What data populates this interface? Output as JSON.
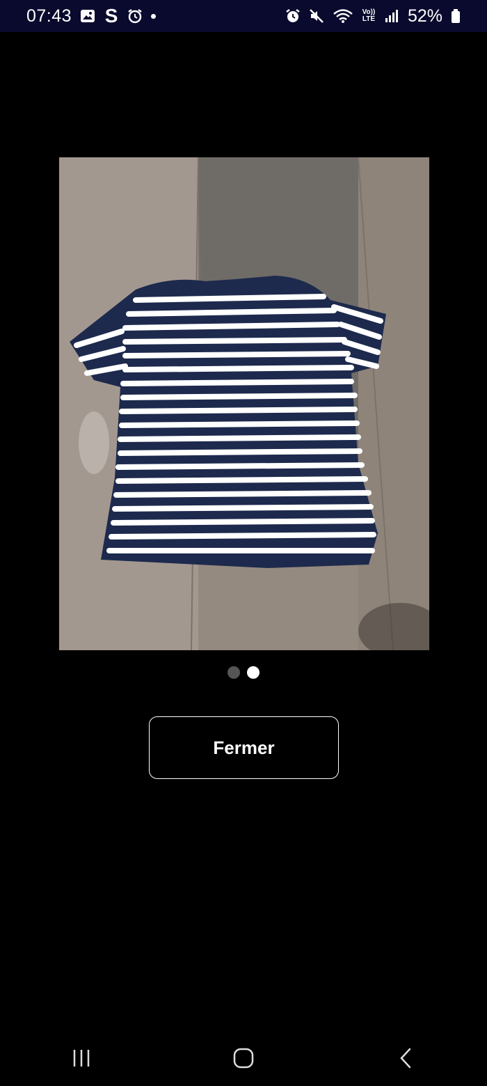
{
  "status_bar": {
    "time": "07:43",
    "battery": "52%",
    "left_icons": [
      "gallery-icon",
      "s-app-icon",
      "alarm-icon",
      "notification-dot"
    ],
    "right_icons": [
      "alarm-icon",
      "mute-icon",
      "wifi-icon",
      "volte-icon",
      "signal-icon",
      "battery-icon"
    ],
    "volte_label_top": "Vo))",
    "volte_label_bottom": "LTE",
    "s_glyph": "S"
  },
  "viewer": {
    "photo_subject": "striped-tshirt-photo",
    "pager": {
      "total": 2,
      "current": 2
    }
  },
  "close_button": {
    "label": "Fermer"
  },
  "nav_bar": {
    "items": [
      "recent-apps-icon",
      "home-icon",
      "back-icon"
    ]
  },
  "colors": {
    "status_bar_bg": "#0a0a2e",
    "background": "#000000",
    "shirt_navy": "#1d2a4d",
    "stripe": "#ffffff"
  }
}
